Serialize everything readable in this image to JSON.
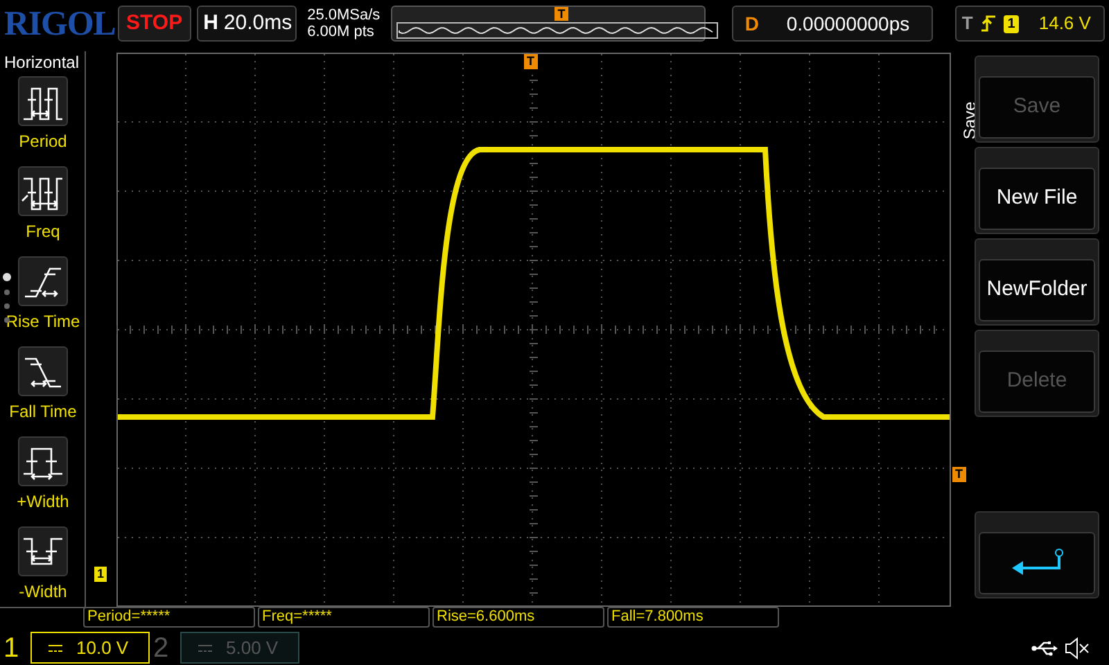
{
  "brand": "RIGOL",
  "run_state": "STOP",
  "timebase": {
    "label": "H",
    "value": "20.0ms"
  },
  "sample_rate": "25.0MSa/s",
  "memory_depth": "6.00M pts",
  "overview_trigger_marker": "T",
  "trigger_position_marker": "T",
  "delay": {
    "label": "D",
    "value": "0.00000000ps"
  },
  "trigger": {
    "label": "T",
    "source": "1",
    "level": "14.6 V"
  },
  "measure_menu": {
    "title": "Horizontal",
    "items": [
      {
        "kind": "period",
        "label": "Period"
      },
      {
        "kind": "freq",
        "label": "Freq"
      },
      {
        "kind": "rise",
        "label": "Rise Time"
      },
      {
        "kind": "fall",
        "label": "Fall Time"
      },
      {
        "kind": "pwidth",
        "label": "+Width"
      },
      {
        "kind": "nwidth",
        "label": "-Width"
      }
    ],
    "pages": [
      {
        "selected": true
      },
      {
        "selected": false
      },
      {
        "selected": false
      },
      {
        "selected": false
      }
    ]
  },
  "channel_marker": "1",
  "trigger_level_marker": "T",
  "softkey_menu": {
    "title": "Save",
    "buttons": [
      {
        "kind": "text",
        "label": "Save",
        "disabled": true
      },
      {
        "kind": "text",
        "label": "New File",
        "disabled": false
      },
      {
        "kind": "text",
        "label": "NewFolder",
        "disabled": false
      },
      {
        "kind": "text",
        "label": "Delete",
        "disabled": true
      },
      {
        "kind": "back"
      }
    ]
  },
  "measurements": [
    "Period=*****",
    "Freq=*****",
    "Rise=6.600ms",
    "Fall=7.800ms"
  ],
  "channels": [
    {
      "number": "1",
      "scale": "10.0 V",
      "active": true
    },
    {
      "number": "2",
      "scale": "5.00 V",
      "active": false
    }
  ]
}
